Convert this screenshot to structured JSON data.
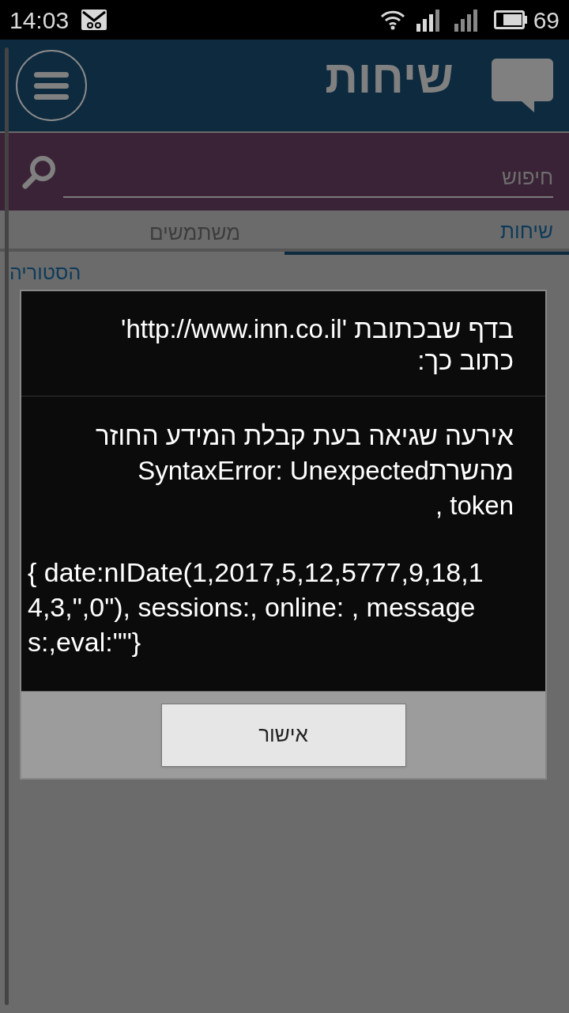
{
  "status_bar": {
    "time": "14:03",
    "battery": "69"
  },
  "header": {
    "title": "שיחות"
  },
  "search": {
    "placeholder": "חיפוש"
  },
  "tabs": [
    {
      "label": "שיחות",
      "selected": true
    },
    {
      "label": "משתמשים",
      "selected": false
    }
  ],
  "history_link": "הסטוריה",
  "dialog": {
    "title": "בדף שבכתובת 'http://www.inn.co.il' כתוב כך:",
    "message": "אירעה שגיאה בעת קבלת המידע החוזר מהשרתSyntaxError: Unexpected token ,",
    "details": "{ date:nIDate(1,2017,5,12,5777,9,18,14,3,\",0\"), sessions:, online: , messages:,eval:\"\"}",
    "button": "אישור"
  }
}
